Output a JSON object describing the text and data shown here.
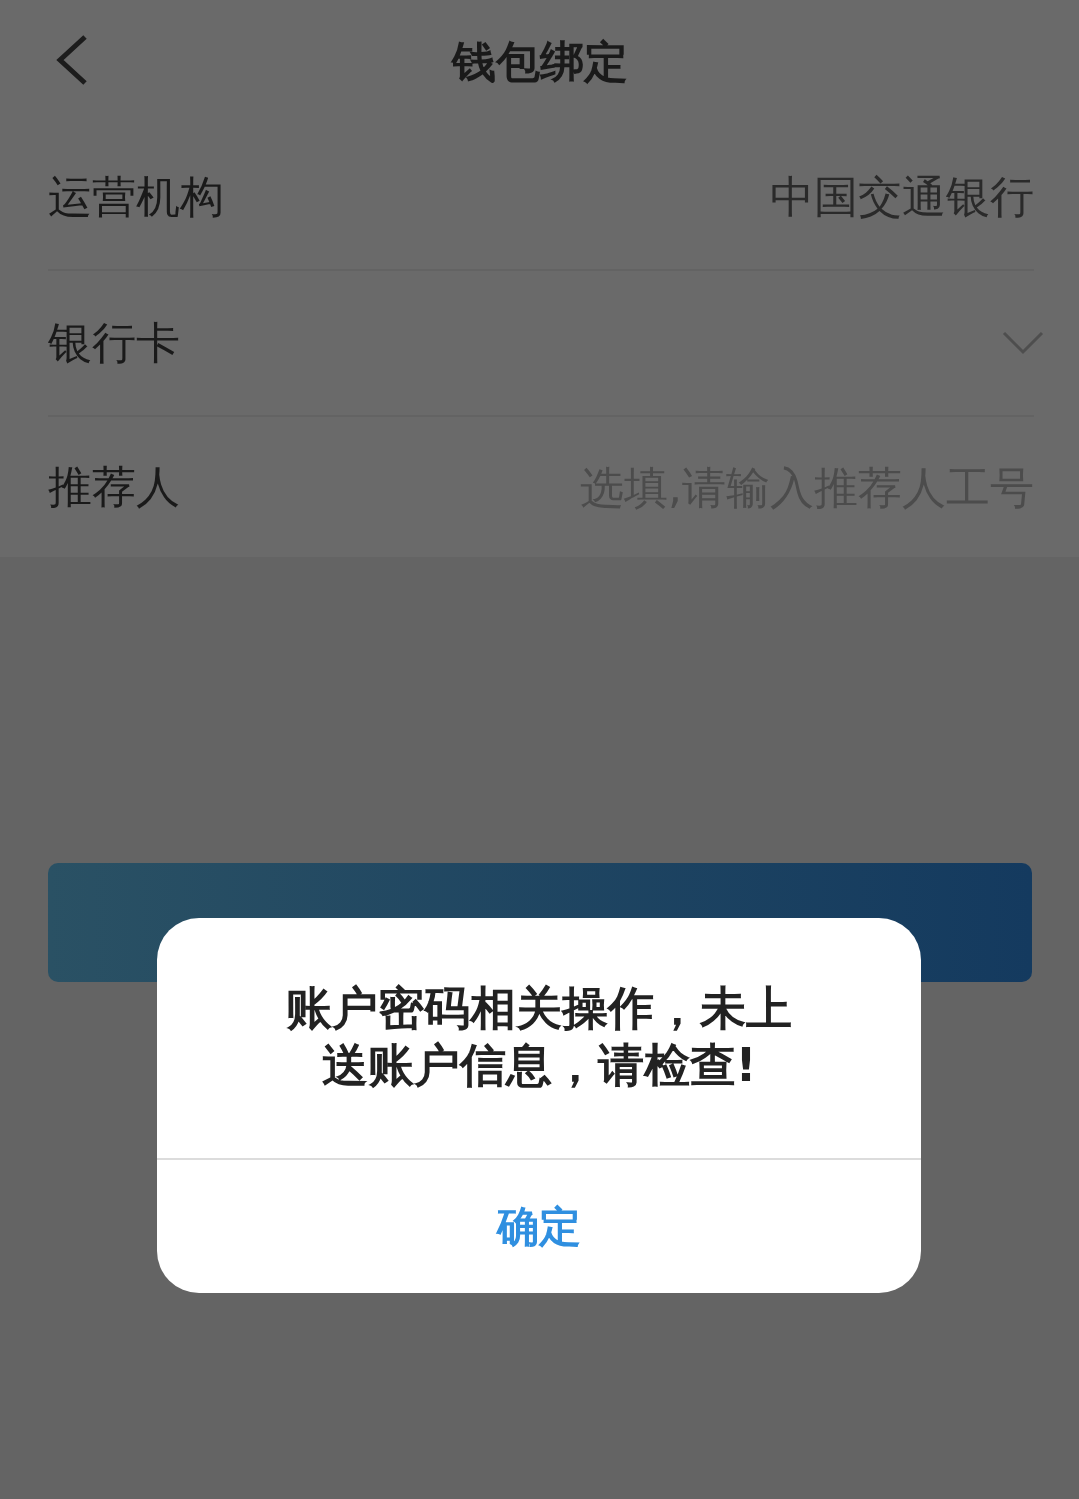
{
  "header": {
    "title": "钱包绑定"
  },
  "rows": [
    {
      "kind": "value",
      "label": "运营机构",
      "value": "中国交通银行"
    },
    {
      "kind": "select",
      "label": "银行卡"
    },
    {
      "kind": "input",
      "label": "推荐人",
      "placeholder": "选填,请输入推荐人工号"
    }
  ],
  "dialog": {
    "message": "账户密码相关操作，未上送账户信息，请检查!",
    "button": "确定"
  }
}
